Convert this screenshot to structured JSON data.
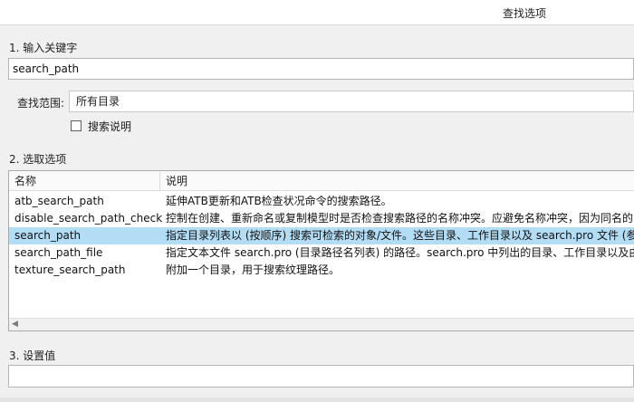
{
  "window": {
    "title": "查找选项"
  },
  "step1": {
    "label": "1. 输入关键字",
    "value": "search_path"
  },
  "search_scope": {
    "label": "查找范围:",
    "selected": "所有目录"
  },
  "search_desc_checkbox": {
    "label": "搜索说明",
    "checked": false
  },
  "step2": {
    "label": "2. 选取选项"
  },
  "table": {
    "columns": [
      "名称",
      "说明"
    ],
    "selected_row": 2,
    "rows": [
      {
        "name": "atb_search_path",
        "desc": "延伸ATB更新和ATB检查状况命令的搜索路径。"
      },
      {
        "name": "disable_search_path_check",
        "desc": "控制在创建、重新命名或复制模型时是否检查搜索路径的名称冲突。应避免名称冲突，因为同名的"
      },
      {
        "name": "search_path",
        "desc": "指定目录列表以 (按顺序) 搜索可检索的对象/文件。这些目录、工作目录以及 search.pro 文件 (参"
      },
      {
        "name": "search_path_file",
        "desc": "指定文本文件 search.pro (目录路径名列表) 的路径。search.pro 中列出的目录、工作目录以及由"
      },
      {
        "name": "texture_search_path",
        "desc": "附加一个目录，用于搜索纹理路径。"
      }
    ]
  },
  "step3": {
    "label": "3. 设置值",
    "value": ""
  },
  "colors": {
    "selection": "#b3dcf5",
    "window_bg": "#f0f0f0"
  }
}
